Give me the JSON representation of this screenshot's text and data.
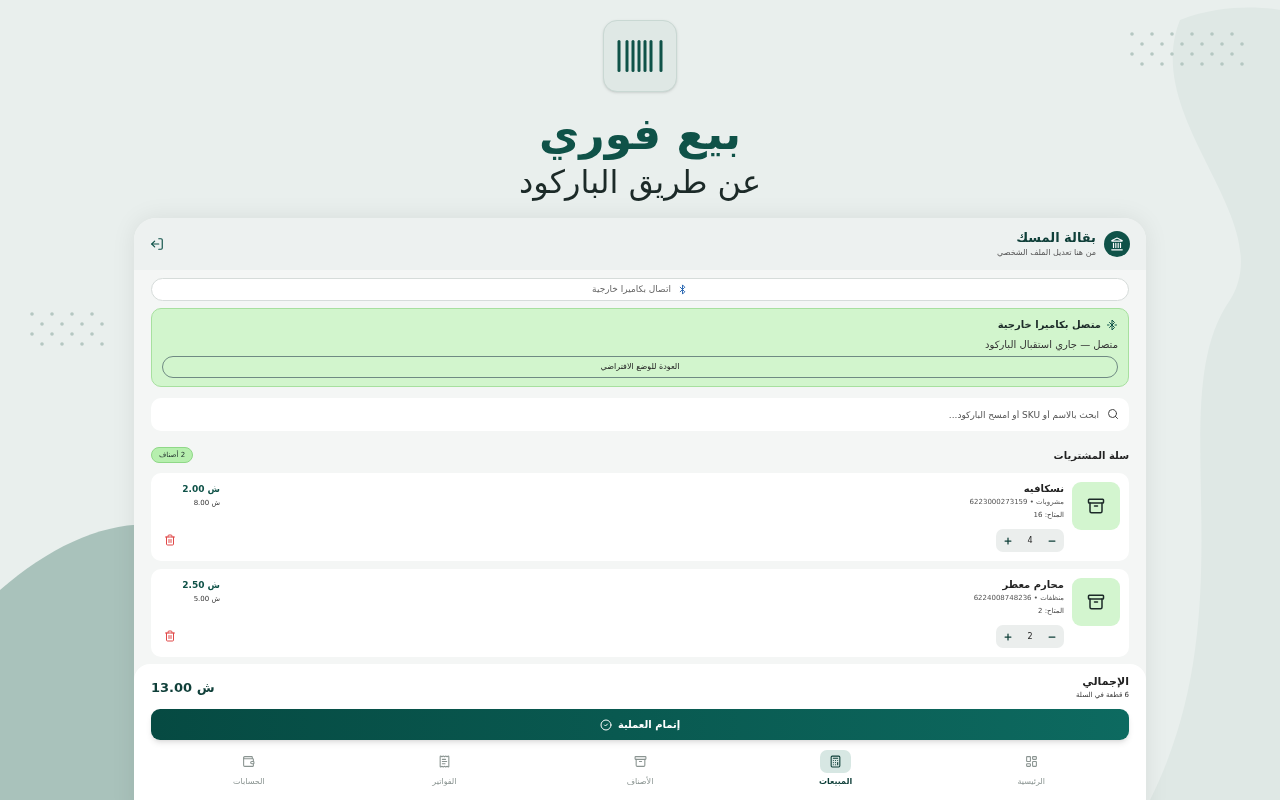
{
  "hero": {
    "title": "بيع فوري",
    "subtitle": "عن طريق الباركود"
  },
  "header": {
    "store_name": "بقالة المسك",
    "hint": "من هنا تعديل الملف الشخصي"
  },
  "connect_button": {
    "label": "اتصال بكاميرا خارجية"
  },
  "connection": {
    "connected": true,
    "title": "متصل بكاميرا خارجية",
    "status": "متصل — جاري استقبال الباركود",
    "button": "العودة للوضع الافتراضي"
  },
  "search": {
    "placeholder": "ابحث بالاسم أو SKU أو امسح الباركود..."
  },
  "cart": {
    "title": "سلة المشتريات",
    "count_badge": "2 أصناف"
  },
  "items": [
    {
      "name": "نسكافيه",
      "meta": "مشروبات • 6223000273159",
      "available": "المتاح: 16",
      "quantity": "4",
      "unit_price": "2.00 ش",
      "line_total": "8.00 ش"
    },
    {
      "name": "محارم معطر",
      "meta": "منظفات • 6224008748236",
      "available": "المتاح: 2",
      "quantity": "2",
      "unit_price": "2.50 ش",
      "line_total": "5.00 ش"
    }
  ],
  "summary": {
    "label": "الإجمالي",
    "pieces": "6 قطعة في السلة",
    "total": "13.00 ش",
    "checkout_button": "إتمام العملية"
  },
  "nav": [
    {
      "label": "الرئيسية",
      "selected": false
    },
    {
      "label": "المبيعات",
      "selected": true
    },
    {
      "label": "الأصناف",
      "selected": false
    },
    {
      "label": "الفواتير",
      "selected": false
    },
    {
      "label": "الحسابات",
      "selected": false
    }
  ]
}
